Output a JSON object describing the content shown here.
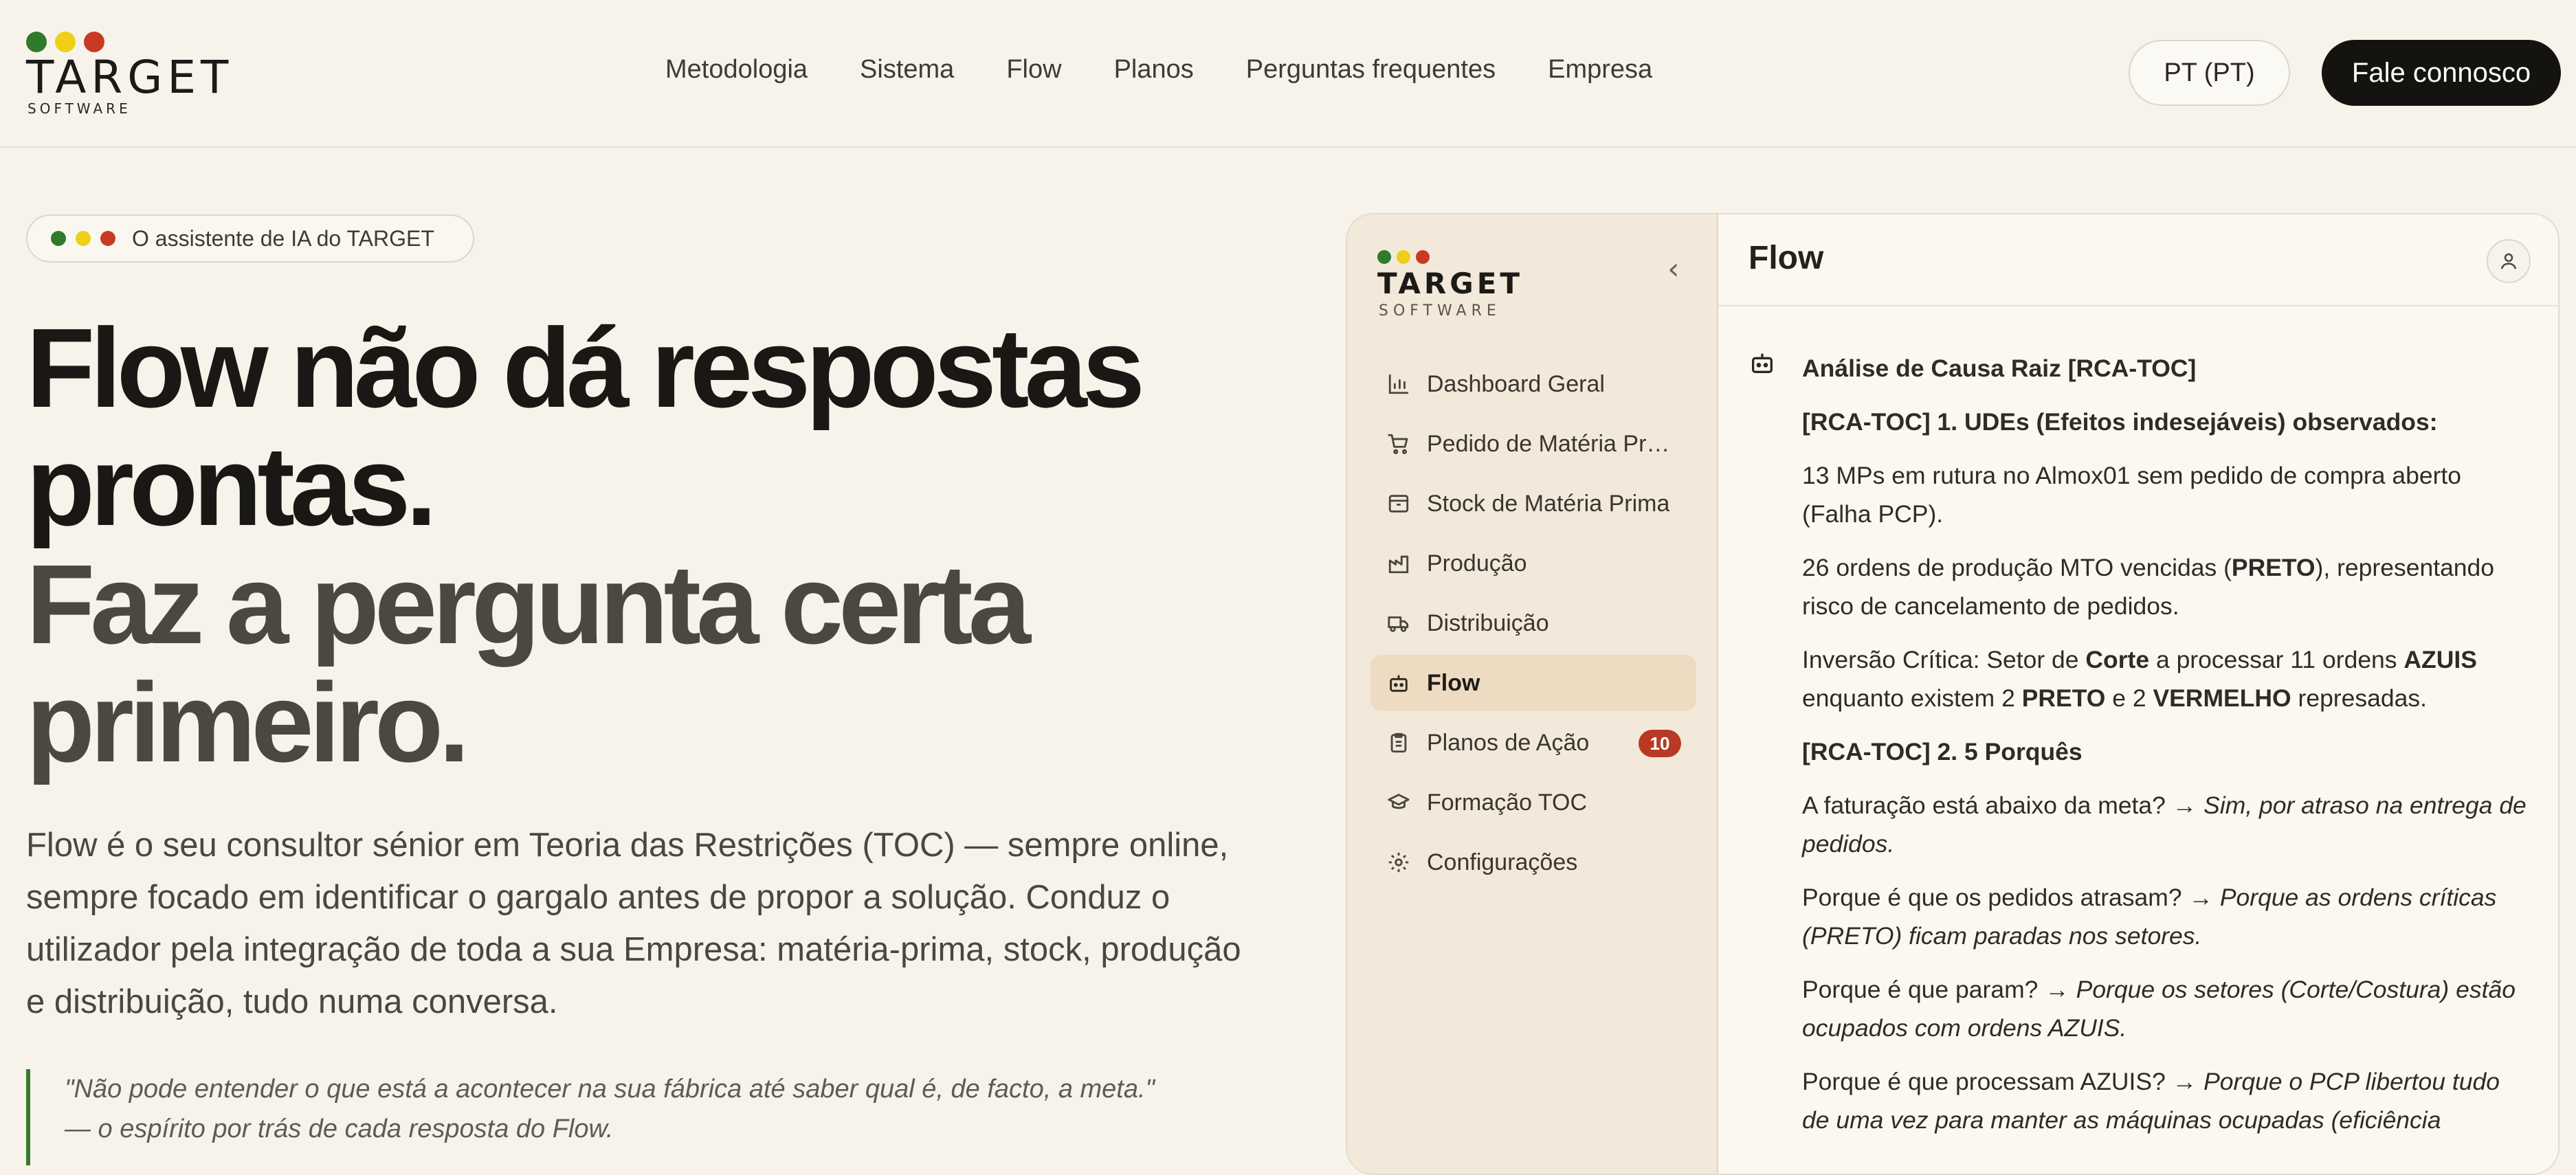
{
  "brand": {
    "name": "TARGET",
    "sub": "SOFTWARE",
    "dot_colors": [
      "#2f7a2c",
      "#f0cf18",
      "#c93a23"
    ]
  },
  "nav": {
    "items": [
      "Metodologia",
      "Sistema",
      "Flow",
      "Planos",
      "Perguntas frequentes",
      "Empresa"
    ],
    "lang_label": "PT (PT)",
    "cta_label": "Fale connosco"
  },
  "hero": {
    "pill_label": "O assistente de IA do TARGET",
    "title_line1": "Flow não dá respostas prontas.",
    "title_line2": "Faz a pergunta certa primeiro.",
    "lead": "Flow é o seu consultor sénior em Teoria das Restrições (TOC) — sempre online, sempre focado em identificar o gargalo antes de propor a solução. Conduz o utilizador pela integração de toda a sua Empresa: matéria-prima, stock, produção e distribuição, tudo numa conversa.",
    "quote_line1": "\"Não pode entender o que está a acontecer na sua fábrica até saber qual é, de facto, a meta.\"",
    "quote_line2": "— o espírito por trás de cada resposta do Flow."
  },
  "app": {
    "brand_name": "TARGET",
    "brand_sub": "SOFTWARE",
    "title": "Flow",
    "sidebar": [
      {
        "label": "Dashboard Geral",
        "icon": "bar-chart-icon"
      },
      {
        "label": "Pedido de Matéria Prima",
        "icon": "cart-icon"
      },
      {
        "label": "Stock de Matéria Prima",
        "icon": "box-icon"
      },
      {
        "label": "Produção",
        "icon": "factory-icon"
      },
      {
        "label": "Distribuição",
        "icon": "truck-icon"
      },
      {
        "label": "Flow",
        "icon": "bot-icon",
        "active": true
      },
      {
        "label": "Planos de Ação",
        "icon": "clipboard-icon",
        "badge": "10"
      },
      {
        "label": "Formação TOC",
        "icon": "graduation-cap-icon"
      },
      {
        "label": "Configurações",
        "icon": "gear-icon"
      }
    ],
    "message": {
      "title": "Análise de Causa Raiz [RCA-TOC]",
      "section1": "[RCA-TOC] 1. UDEs (Efeitos indesejáveis) observados:",
      "ude1": "13 MPs em rutura no Almox01 sem pedido de compra aberto (Falha PCP).",
      "ude2_a": "26 ordens de produção MTO vencidas (",
      "ude2_b": "PRETO",
      "ude2_c": "), representando risco de cancelamento de pedidos.",
      "ude3_a": "Inversão Crítica: Setor de ",
      "ude3_b": "Corte",
      "ude3_c": " a processar 11 ordens ",
      "ude3_d": "AZUIS",
      "ude3_e": " enquanto existem 2 ",
      "ude3_f": "PRETO",
      "ude3_g": " e 2 ",
      "ude3_h": "VERMELHO",
      "ude3_i": " represadas.",
      "section2": "[RCA-TOC] 2. 5 Porquês",
      "q1": "A faturação está abaixo da meta? → ",
      "a1": "Sim, por atraso na entrega de pedidos.",
      "q2": "Porque é que os pedidos atrasam? → ",
      "a2": "Porque as ordens críticas (PRETO) ficam paradas nos setores.",
      "q3": "Porque é que param? → ",
      "a3": "Porque os setores (Corte/Costura) estão ocupados com ordens AZUIS.",
      "q4": "Porque é que processam AZUIS? → ",
      "a4": "Porque o PCP libertou tudo de uma vez para manter as máquinas ocupadas (eficiência"
    }
  }
}
